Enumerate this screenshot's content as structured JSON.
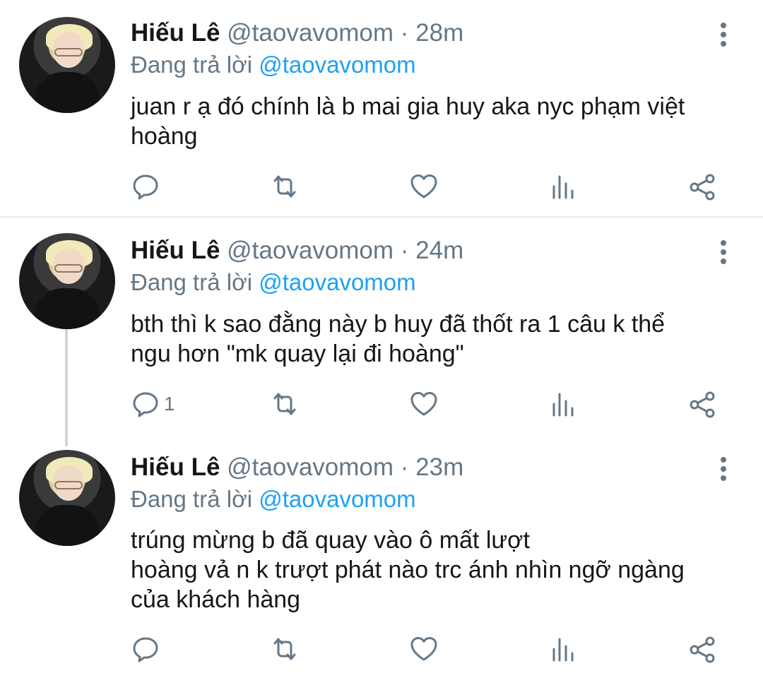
{
  "tweets": [
    {
      "name": "Hiếu Lê",
      "handle": "@taovavomom",
      "sep": " · ",
      "time": "28m",
      "replying_prefix": "Đang trả lời ",
      "replying_to": "@taovavomom",
      "text": "juan r ạ đó chính là b mai gia huy aka nyc phạm việt hoàng",
      "reply_count": ""
    },
    {
      "name": "Hiếu Lê",
      "handle": "@taovavomom",
      "sep": " · ",
      "time": "24m",
      "replying_prefix": "Đang trả lời ",
      "replying_to": "@taovavomom",
      "text": "bth thì k sao đằng này b huy đã thốt ra 1 câu k thể ngu hơn \"mk quay lại đi hoàng\"",
      "reply_count": "1"
    },
    {
      "name": "Hiếu Lê",
      "handle": "@taovavomom",
      "sep": " · ",
      "time": "23m",
      "replying_prefix": "Đang trả lời ",
      "replying_to": "@taovavomom",
      "text_lines": [
        "trúng mừng b đã quay vào ô mất lượt",
        "hoàng vả n k trượt phát nào trc ánh nhìn ngỡ ngàng",
        "của khách hàng"
      ],
      "reply_count": ""
    }
  ],
  "icons": [
    "reply-icon",
    "retweet-icon",
    "like-icon",
    "analytics-icon",
    "share-icon",
    "more-icon"
  ],
  "colors": {
    "text": "#14171a",
    "secondary": "#657786",
    "link": "#1da1f2",
    "divider": "#e6ecf0"
  }
}
